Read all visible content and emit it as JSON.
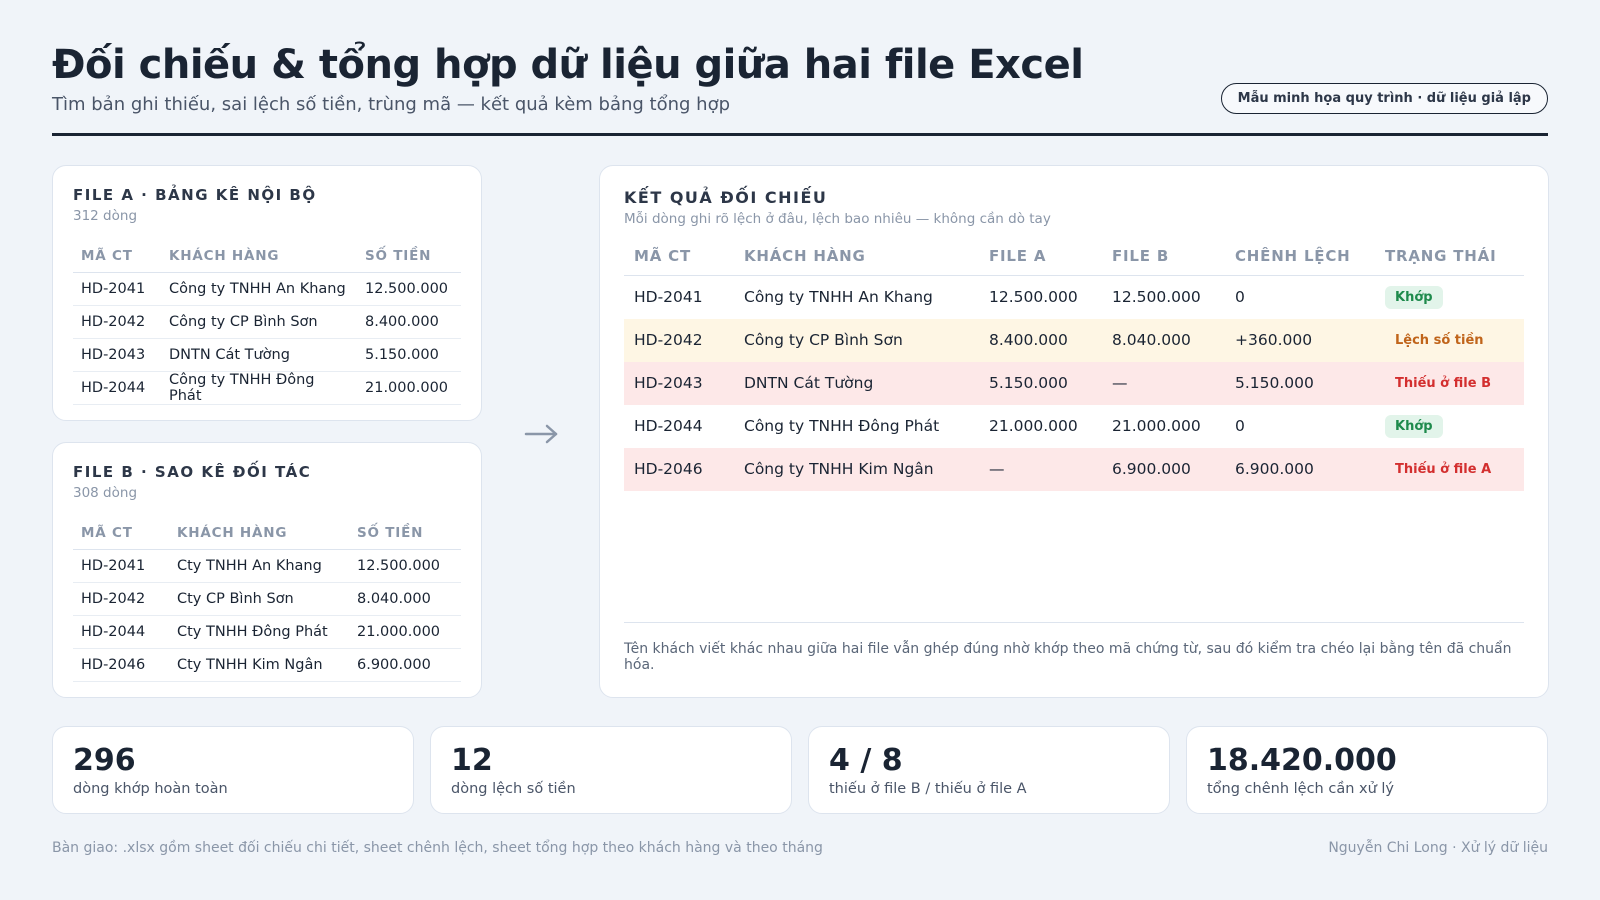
{
  "header": {
    "title": "Đối chiếu & tổng hợp dữ liệu giữa hai file Excel",
    "subtitle": "Tìm bản ghi thiếu, sai lệch số tiền, trùng mã — kết quả kèm bảng tổng hợp",
    "badge": "Mẫu minh họa quy trình · dữ liệu giả lập"
  },
  "fileA": {
    "title": "FILE A · BẢNG KÊ NỘI BỘ",
    "count": "312 dòng",
    "columns": [
      "MÃ CT",
      "KHÁCH HÀNG",
      "SỐ TIỀN"
    ],
    "rows": [
      [
        "HD-2041",
        "Công ty TNHH An Khang",
        "12.500.000"
      ],
      [
        "HD-2042",
        "Công ty CP Bình Sơn",
        "8.400.000"
      ],
      [
        "HD-2043",
        "DNTN Cát Tường",
        "5.150.000"
      ],
      [
        "HD-2044",
        "Công ty TNHH Đông Phát",
        "21.000.000"
      ]
    ]
  },
  "fileB": {
    "title": "FILE B · SAO KÊ ĐỐI TÁC",
    "count": "308 dòng",
    "columns": [
      "MÃ CT",
      "KHÁCH HÀNG",
      "SỐ TIỀN"
    ],
    "rows": [
      [
        "HD-2041",
        "Cty TNHH An Khang",
        "12.500.000"
      ],
      [
        "HD-2042",
        "Cty CP Bình Sơn",
        "8.040.000"
      ],
      [
        "HD-2044",
        "Cty TNHH Đông Phát",
        "21.000.000"
      ],
      [
        "HD-2046",
        "Cty TNHH Kim Ngân",
        "6.900.000"
      ]
    ]
  },
  "result": {
    "title": "KẾT QUẢ ĐỐI CHIẾU",
    "subtitle": "Mỗi dòng ghi rõ lệch ở đâu, lệch bao nhiêu — không cần dò tay",
    "columns": [
      "MÃ CT",
      "KHÁCH HÀNG",
      "FILE A",
      "FILE B",
      "CHÊNH LỆCH",
      "TRẠNG THÁI"
    ],
    "rows": [
      [
        "HD-2041",
        "Công ty TNHH An Khang",
        "12.500.000",
        "12.500.000",
        "0",
        "Khớp"
      ],
      [
        "HD-2042",
        "Công ty CP Bình Sơn",
        "8.400.000",
        "8.040.000",
        "+360.000",
        "Lệch số tiền"
      ],
      [
        "HD-2043",
        "DNTN Cát Tường",
        "5.150.000",
        "—",
        "5.150.000",
        "Thiếu ở file B"
      ],
      [
        "HD-2044",
        "Công ty TNHH Đông Phát",
        "21.000.000",
        "21.000.000",
        "0",
        "Khớp"
      ],
      [
        "HD-2046",
        "Công ty TNHH Kim Ngân",
        "—",
        "6.900.000",
        "6.900.000",
        "Thiếu ở file A"
      ]
    ],
    "row_status": [
      "ok",
      "warn",
      "err",
      "ok",
      "err"
    ],
    "note": "Tên khách viết khác nhau giữa hai file vẫn ghép đúng nhờ khớp theo mã chứng từ, sau đó kiểm tra chéo lại bằng tên đã chuẩn hóa."
  },
  "stats": [
    {
      "value": "296",
      "label": "dòng khớp hoàn toàn"
    },
    {
      "value": "12",
      "label": "dòng lệch số tiền"
    },
    {
      "value": "4 / 8",
      "label": "thiếu ở file B / thiếu ở file A"
    },
    {
      "value": "18.420.000",
      "label": "tổng chênh lệch cần xử lý"
    }
  ],
  "footer": {
    "left": "Bàn giao: .xlsx gồm sheet đối chiếu chi tiết, sheet chênh lệch, sheet tổng hợp theo khách hàng và theo tháng",
    "right": "Nguyễn Chi Long · Xử lý dữ liệu"
  },
  "colors": {
    "ok": "#1e8a4c",
    "warn": "#c0641a",
    "err": "#d32f2f"
  }
}
